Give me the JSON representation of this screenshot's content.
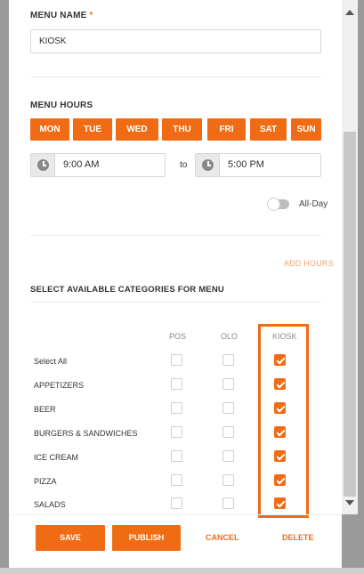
{
  "form": {
    "menu_name_label": "MENU NAME",
    "required_mark": "*",
    "menu_name_value": "KIOSK",
    "menu_hours_label": "MENU HOURS",
    "days": [
      "MON",
      "TUE",
      "WED",
      "THU",
      "FRI",
      "SAT",
      "SUN"
    ],
    "start_time": "9:00 AM",
    "to_label": "to",
    "end_time": "5:00 PM",
    "all_day_label": "All-Day",
    "all_day_on": false,
    "add_hours_label": "ADD HOURS",
    "categories_label": "SELECT AVAILABLE CATEGORIES FOR MENU"
  },
  "columns": [
    "POS",
    "OLO",
    "KIOSK"
  ],
  "rows": [
    {
      "label": "Select All",
      "pos": false,
      "olo": false,
      "kiosk": true
    },
    {
      "label": "APPETIZERS",
      "pos": false,
      "olo": false,
      "kiosk": true
    },
    {
      "label": "BEER",
      "pos": false,
      "olo": false,
      "kiosk": true
    },
    {
      "label": "BURGERS & SANDWICHES",
      "pos": false,
      "olo": false,
      "kiosk": true
    },
    {
      "label": "ICE CREAM",
      "pos": false,
      "olo": false,
      "kiosk": true
    },
    {
      "label": "PIZZA",
      "pos": false,
      "olo": false,
      "kiosk": true
    },
    {
      "label": "SALADS",
      "pos": false,
      "olo": false,
      "kiosk": true
    }
  ],
  "footer": {
    "save": "SAVE",
    "publish": "PUBLISH",
    "cancel": "CANCEL",
    "delete": "DELETE"
  },
  "colors": {
    "accent": "#ef6c15",
    "add_hours": "#f5a66c"
  },
  "icons": [
    "clock-icon",
    "scroll-up-arrow-icon",
    "scroll-down-arrow-icon"
  ]
}
